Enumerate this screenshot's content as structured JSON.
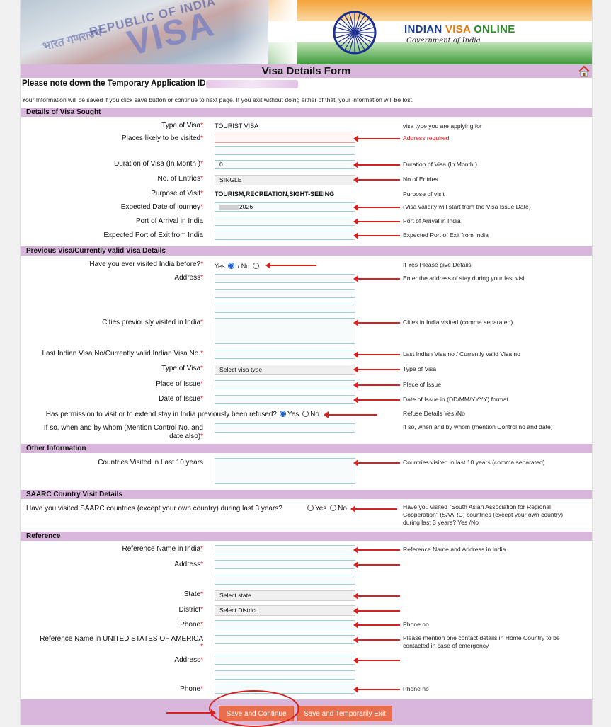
{
  "header": {
    "stamp_visa": "VISA",
    "stamp_republic": "REPUBLIC OF INDIA",
    "stamp_hindi": "भारत गणराज्य",
    "brand_part1": "INDIAN",
    "brand_part2": "VISA",
    "brand_part3": "ONLINE",
    "gov_line": "Government of India"
  },
  "title": "Visa Details Form",
  "temp_id_label": "Please note down the Temporary Application ID :",
  "info_line": "Your Information will be saved if you click save button or continue to next page. If you exit without doing either of that, your information will be lost.",
  "sections": {
    "visa_sought": "Details of Visa Sought",
    "previous_visa": "Previous Visa/Currently valid Visa Details",
    "other_info": "Other Information",
    "saarc": "SAARC Country Visit Details",
    "reference": "Reference"
  },
  "visa_sought": {
    "type_label": "Type of Visa",
    "type_value": "TOURIST VISA",
    "type_hint": "visa type you are applying for",
    "places_label": "Places likely to be visited",
    "places_hint": "Address required",
    "duration_label": "Duration of Visa (In Month )",
    "duration_value": "0",
    "duration_hint": "Duration of Visa (In Month )",
    "entries_label": "No. of Entries",
    "entries_value": "SINGLE",
    "entries_hint": "No of Entries",
    "purpose_label": "Purpose of Visit",
    "purpose_value": "TOURISM,RECREATION,SIGHT-SEEING",
    "purpose_hint": "Purpose of visit",
    "journey_label": "Expected Date of journey",
    "journey_value": "2026",
    "journey_hint": "(Visa validity will start from the Visa Issue Date)",
    "arrival_label": "Port of Arrival in India",
    "arrival_hint": "Port of Arrival in India",
    "exit_label": "Expected Port of Exit from India",
    "exit_hint": "Expected Port of Exit from India"
  },
  "previous_visa": {
    "visited_label": "Have you ever visited India before?",
    "yes": "Yes",
    "no": "/ No",
    "visited_hint": "If Yes Please give Details",
    "address_label": "Address",
    "address_hint": "Enter the address of stay during your last visit",
    "cities_label": "Cities previously visited in India",
    "cities_hint": "Cities in India visited (comma separated)",
    "last_visa_label": "Last Indian Visa No/Currently valid Indian Visa No.",
    "last_visa_hint": "Last Indian Visa no / Currently valid Visa no",
    "type_label": "Type of Visa",
    "type_value": "Select visa type",
    "type_hint": "Type of Visa",
    "place_label": "Place of Issue",
    "place_hint": "Place of Issue",
    "date_label": "Date of Issue",
    "date_hint": "Date of Issue in (DD/MM/YYYY) format",
    "refused_label": "Has permission to visit or to extend stay in India previously been refused?",
    "refused_yes": "Yes",
    "refused_no": "No",
    "refused_hint": "Refuse Details Yes /No",
    "control_label_1": "If so, when and by whom (Mention Control No. and",
    "control_label_2": "date also)",
    "control_hint": "If so, when and by whom (mention Control no and date)"
  },
  "other_info": {
    "countries_label": "Countries Visited in Last 10 years",
    "countries_hint": "Countries visited in last 10 years (comma separated)"
  },
  "saarc": {
    "question": "Have you visited SAARC countries (except your own country) during last 3 years?",
    "yes": "Yes",
    "no": "No",
    "hint": "Have you visited \"South Asian Association for Regional Cooperation\" (SAARC) countries (except your own country) during last 3 years? Yes /No"
  },
  "reference": {
    "name_india_label": "Reference Name in India",
    "name_india_hint": "Reference Name and Address in India",
    "address_label": "Address",
    "state_label": "State",
    "state_value": "Select state",
    "district_label": "District",
    "district_value": "Select District",
    "phone_label": "Phone",
    "phone_hint": "Phone no",
    "home_name_label": "Reference Name in UNITED STATES OF AMERICA",
    "home_name_hint": "Please mention one contact details in Home Country to be contacted in case of emergency",
    "home_address_label": "Address",
    "home_phone_label": "Phone",
    "home_phone_hint": "Phone no"
  },
  "buttons": {
    "save_continue": "Save and Continue",
    "save_exit": "Save and Temporarily Exit"
  },
  "required_mark": "*",
  "colors": {
    "section_bg": "#d9b7dc",
    "arrow": "#d32222",
    "button": "#e96e4b",
    "input_border": "#9bd0d4"
  }
}
